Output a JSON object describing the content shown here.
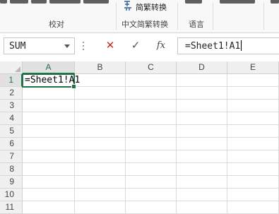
{
  "ribbon": {
    "groups": [
      {
        "label": "校对"
      },
      {
        "label": "中文简繁转换",
        "button": "简繁转换"
      },
      {
        "label": "语言"
      }
    ]
  },
  "formula_bar": {
    "name_box": "SUM",
    "cancel_symbol": "✕",
    "enter_symbol": "✓",
    "fx_label": "fx",
    "formula": "=Sheet1!A1"
  },
  "grid": {
    "columns": [
      "A",
      "B",
      "C",
      "D",
      "E"
    ],
    "rows": [
      "1",
      "2",
      "3",
      "4",
      "5",
      "6",
      "7",
      "8",
      "9",
      "10",
      "11"
    ],
    "active_cell": {
      "ref": "A1",
      "content": "=Sheet1!A1"
    }
  },
  "colors": {
    "accent": "#217346",
    "cancel_red": "#c42b1c",
    "header_bg": "#f0f0f0"
  },
  "icons": [
    "dropdown-arrow-icon",
    "cancel-icon",
    "enter-icon",
    "function-icon",
    "convert-icon",
    "select-all-icon"
  ]
}
